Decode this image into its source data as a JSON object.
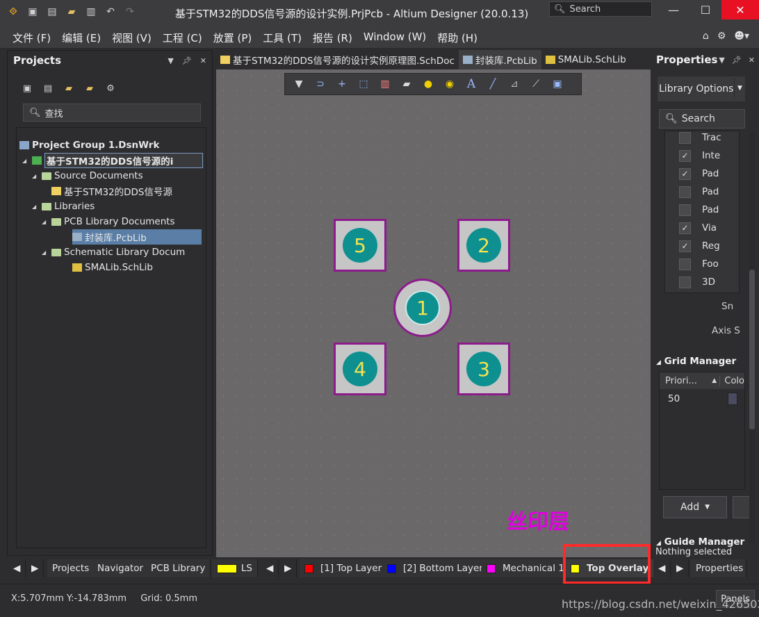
{
  "titlebar": {
    "title": "基于STM32的DDS信号源的设计实例.PrjPcb - Altium Designer (20.0.13)",
    "search_placeholder": "Search",
    "icons": [
      "altium-logo-icon",
      "save-icon",
      "save-all-icon",
      "open-icon",
      "open-project-icon",
      "undo-icon",
      "redo-icon"
    ]
  },
  "menu": {
    "items": [
      "文件 (F)",
      "编辑 (E)",
      "视图 (V)",
      "工程 (C)",
      "放置 (P)",
      "工具 (T)",
      "报告 (R)",
      "Window (W)",
      "帮助 (H)"
    ]
  },
  "projects_panel": {
    "title": "Projects",
    "search_placeholder": "查找",
    "tree": [
      {
        "label": "Project Group 1.DsnWrk",
        "bold": true
      },
      {
        "label": "基于STM32的DDS信号源的i",
        "bold": true
      },
      {
        "label": "Source Documents"
      },
      {
        "label": "基于STM32的DDS信号源"
      },
      {
        "label": "Libraries"
      },
      {
        "label": "PCB Library Documents"
      },
      {
        "label": "封装库.PcbLib"
      },
      {
        "label": "Schematic Library Docum"
      },
      {
        "label": "SMALib.SchLib"
      }
    ]
  },
  "doc_tabs": [
    {
      "label": "基于STM32的DDS信号源的设计实例原理图.SchDoc",
      "active": false
    },
    {
      "label": "封装库.PcbLib",
      "active": true
    },
    {
      "label": "SMALib.SchLib",
      "active": false
    }
  ],
  "canvas": {
    "pads": [
      "5",
      "2",
      "1",
      "4",
      "3"
    ],
    "annotation": "丝印层",
    "toolbar_icons": [
      "filter-icon",
      "route-icon",
      "cross-icon",
      "select-rect-icon",
      "chart-icon",
      "component-icon",
      "via-icon",
      "pad-icon",
      "text-icon",
      "line-icon",
      "dimension-icon",
      "ruler-icon",
      "fill-icon"
    ]
  },
  "properties_panel": {
    "title": "Properties",
    "dropdown_value": "Library Options",
    "search_placeholder": "Search",
    "layers": [
      {
        "label": "Trac",
        "checked": false
      },
      {
        "label": "Inte",
        "checked": true
      },
      {
        "label": "Pad",
        "checked": true
      },
      {
        "label": "Pad",
        "checked": false
      },
      {
        "label": "Pad",
        "checked": false
      },
      {
        "label": "Via",
        "checked": true
      },
      {
        "label": "Reg",
        "checked": true
      },
      {
        "label": "Foo",
        "checked": false
      },
      {
        "label": "3D",
        "checked": false
      }
    ],
    "snap_label": "Sn",
    "axis_label": "Axis S",
    "grid_manager_title": "Grid Manager",
    "grid_headers": [
      "Priori...",
      "Colo"
    ],
    "grid_value": "50",
    "add_label": "Add",
    "guide_manager_title": "Guide Manager"
  },
  "bottom": {
    "left_tabs": [
      "Projects",
      "Navigator",
      "PCB Library"
    ],
    "ls_label": "LS",
    "layers": [
      {
        "label": "[1] Top Layer",
        "color": "#ff0000"
      },
      {
        "label": "[2] Bottom Layer",
        "color": "#0000ff"
      },
      {
        "label": "Mechanical 1",
        "color": "#ff00ff"
      },
      {
        "label": "Top Overlay",
        "color": "#ffff00"
      }
    ],
    "properties_tab": "Properties",
    "nothing_selected": "Nothing selected"
  },
  "status": {
    "coords": "X:5.707mm Y:-14.783mm",
    "grid": "Grid: 0.5mm",
    "panels_label": "Panels",
    "watermark": "https://blog.csdn.net/weixin_42650213"
  }
}
